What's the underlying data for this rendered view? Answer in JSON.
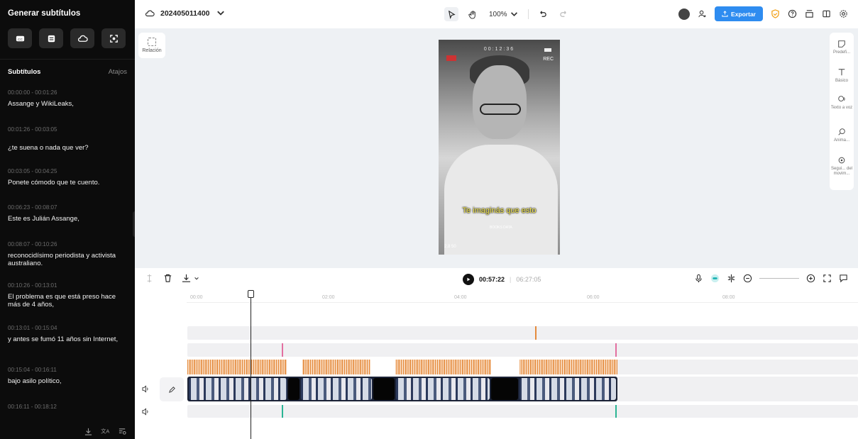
{
  "left_panel": {
    "title": "Generar subtítulos",
    "tools": [
      "captions-icon",
      "text-icon",
      "cloud-icon",
      "auto-caption-icon"
    ],
    "section_label": "Subtítulos",
    "shortcuts_label": "Atajos",
    "subtitles": [
      {
        "time": "00:00:00 - 00:01:26",
        "text": "Assange y WikiLeaks,"
      },
      {
        "time": "00:01:26 - 00:03:05",
        "text": "¿te suena o nada que ver?"
      },
      {
        "time": "00:03:05 - 00:04:25",
        "text": "Ponete cómodo que te cuento."
      },
      {
        "time": "00:06:23 - 00:08:07",
        "text": "Este es Julián Assange,"
      },
      {
        "time": "00:08:07 - 00:10:26",
        "text": "reconocidísimo periodista y activista australiano."
      },
      {
        "time": "00:10:26 - 00:13:01",
        "text": "El problema es que está preso hace más de 4 años,"
      },
      {
        "time": "00:13:01 - 00:15:04",
        "text": "y antes se fumó 11 años sin Internet,"
      },
      {
        "time": "00:15:04 - 00:16:11",
        "text": "bajo asilo político,"
      },
      {
        "time": "00:16:11 - 00:18:12",
        "text": ""
      }
    ],
    "footer_icons": [
      "download-icon",
      "translate-icon",
      "search-list-icon"
    ]
  },
  "topbar": {
    "project_name": "202405011400",
    "zoom": "100%",
    "export_label": "Exportar"
  },
  "canvas": {
    "ratio_label": "Relación",
    "caption": "Te imaginás que esto",
    "overlay_time": "00:12:36",
    "overlay_rec": "REC",
    "watermark": "BOOKS DATA",
    "overlay_info": "2.8  50",
    "right_tools": [
      {
        "icon": "preset-icon",
        "label": "Predefi..."
      },
      {
        "icon": "text-T-icon",
        "label": "Básico"
      },
      {
        "icon": "text-to-speech-icon",
        "label": "Texto a voz"
      },
      {
        "icon": "animation-icon",
        "label": "Anima..."
      },
      {
        "icon": "motion-tracking-icon",
        "label": "Segui... del movim..."
      }
    ]
  },
  "timeline": {
    "current_time": "00:57:22",
    "separator": "|",
    "total_time": "06:27:05",
    "ruler_labels": [
      "00:00",
      "02:00",
      "04:00",
      "06:00",
      "08:00"
    ],
    "colors": {
      "orange": "#e48a3c",
      "pink": "#e36fa0",
      "teal": "#2bb594",
      "accent": "#2e8cf0"
    }
  }
}
